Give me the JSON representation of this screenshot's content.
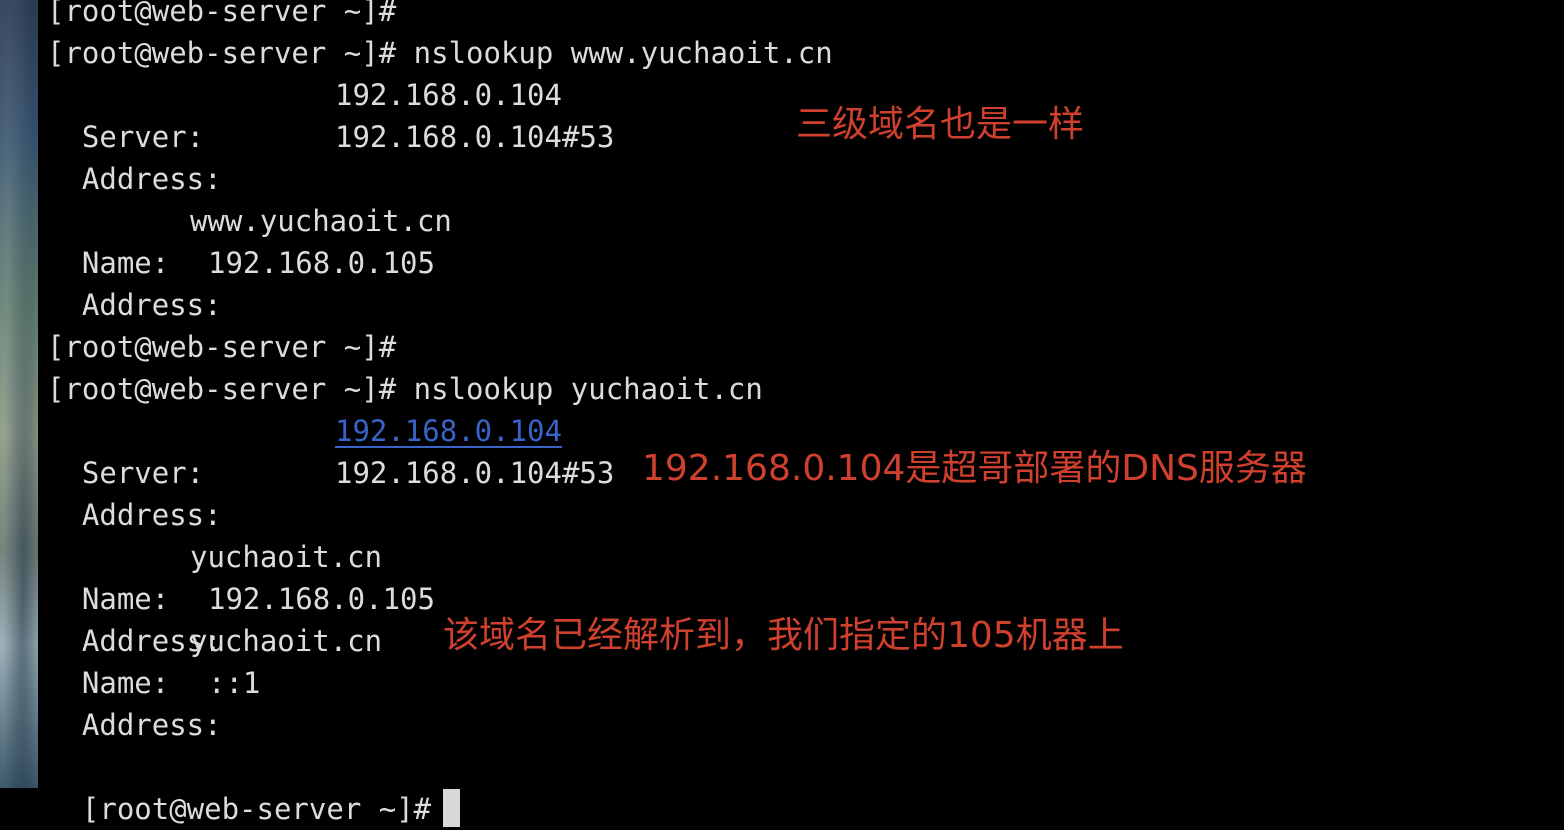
{
  "terminal": {
    "prompt": "[root@web-server ~]#",
    "block1": {
      "command": "[root@web-server ~]# nslookup www.yuchaoit.cn",
      "server_label": "Server:",
      "server_value": "192.168.0.104",
      "address_label": "Address:",
      "address_value": "192.168.0.104#53",
      "name_label": "Name:",
      "name_value": "www.yuchaoit.cn",
      "answer_label": "Address:",
      "answer_value": "192.168.0.105"
    },
    "block2": {
      "prompt_line": "[root@web-server ~]#",
      "command": "[root@web-server ~]# nslookup yuchaoit.cn",
      "server_label": "Server:",
      "server_value": "192.168.0.104",
      "address_label": "Address:",
      "address_value": "192.168.0.104#53",
      "name_label": "Name:",
      "name_value": "yuchaoit.cn",
      "answer_label": "Address:",
      "answer_value": "192.168.0.105",
      "name2_label": "Name:",
      "name2_value": "yuchaoit.cn",
      "answer2_label": "Address:",
      "answer2_value": "::1"
    },
    "final_prompt": "[root@web-server ~]#"
  },
  "annotations": {
    "note1": "三级域名也是一样",
    "note2": "192.168.0.104是超哥部署的DNS服务器",
    "note3": "该域名已经解析到，我们指定的105机器上"
  },
  "colors": {
    "background": "#000000",
    "text": "#dcdcdc",
    "annotation": "#d0402e",
    "link": "#3a63c8"
  }
}
